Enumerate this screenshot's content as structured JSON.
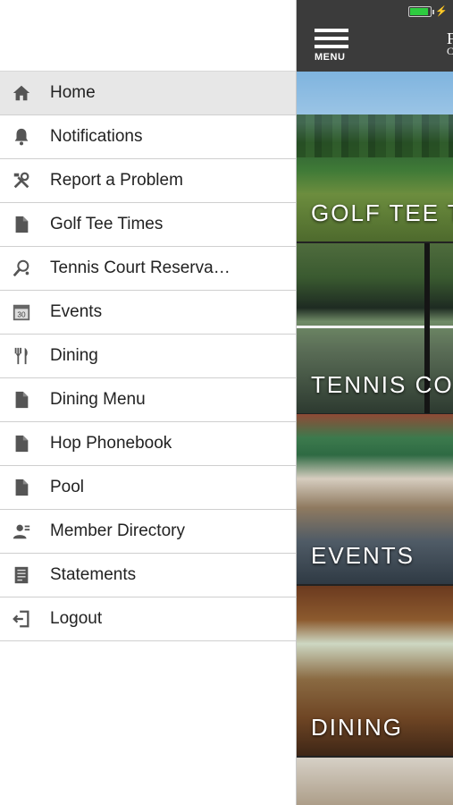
{
  "drawer": {
    "items": [
      {
        "label": "Home",
        "icon": "home-icon",
        "active": true
      },
      {
        "label": "Notifications",
        "icon": "bell-icon"
      },
      {
        "label": "Report a Problem",
        "icon": "tools-icon"
      },
      {
        "label": "Golf Tee Times",
        "icon": "document-icon"
      },
      {
        "label": "Tennis Court Reserva…",
        "icon": "tennis-racket-icon"
      },
      {
        "label": "Events",
        "icon": "calendar-icon"
      },
      {
        "label": "Dining",
        "icon": "fork-knife-icon"
      },
      {
        "label": "Dining Menu",
        "icon": "document-icon"
      },
      {
        "label": "Hop Phonebook",
        "icon": "document-icon"
      },
      {
        "label": "Pool",
        "icon": "document-icon"
      },
      {
        "label": "Member Directory",
        "icon": "member-directory-icon"
      },
      {
        "label": "Statements",
        "icon": "statement-icon"
      },
      {
        "label": "Logout",
        "icon": "logout-icon"
      }
    ],
    "calendar_day": "30"
  },
  "app": {
    "menu_label": "MENU",
    "brand_partial_line1": "F",
    "brand_partial_line2": "C",
    "tiles": [
      {
        "title": "GOLF TEE T"
      },
      {
        "title": "TENNIS CO"
      },
      {
        "title": "EVENTS"
      },
      {
        "title": "DINING"
      }
    ]
  },
  "status_bar": {
    "battery_icon": "battery-icon",
    "charging_icon": "charging-bolt-icon",
    "battery_color": "#2ecc40",
    "battery_level_percent": 90
  },
  "colors": {
    "header_bg": "#3b3b3b",
    "drawer_active_bg": "#e7e7e7",
    "icon_gray": "#555555"
  }
}
